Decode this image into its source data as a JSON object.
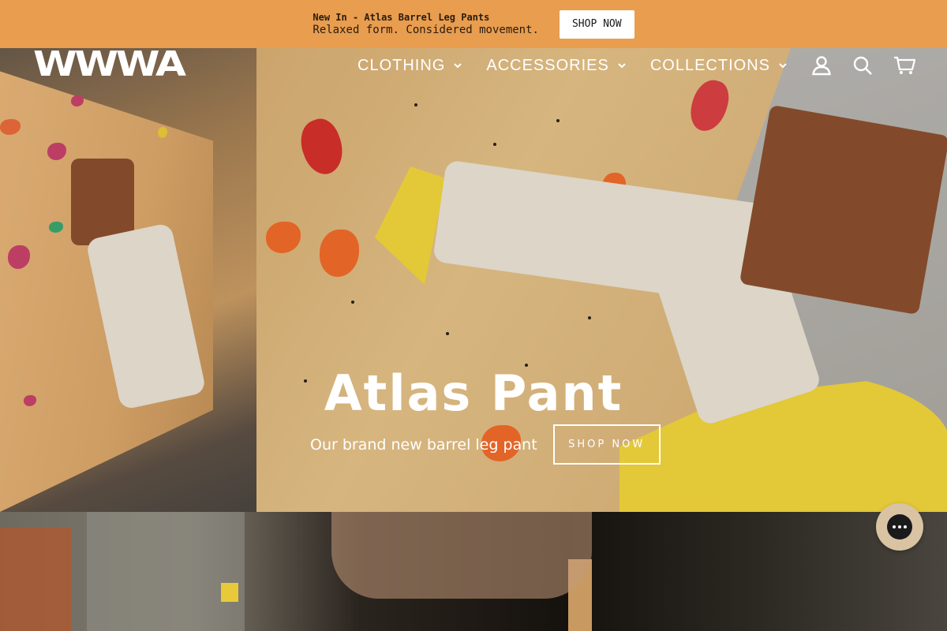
{
  "announcement": {
    "title": "New In - Atlas Barrel Leg Pants",
    "subtitle": "Relaxed form. Considered movement.",
    "button_label": "SHOP NOW"
  },
  "header": {
    "logo_text": "WWWA",
    "nav": [
      {
        "label": "CLOTHING",
        "icon": "chevron-down-icon"
      },
      {
        "label": "ACCESSORIES",
        "icon": "chevron-down-icon"
      },
      {
        "label": "COLLECTIONS",
        "icon": "chevron-down-icon"
      }
    ],
    "icons": [
      "account-icon",
      "search-icon",
      "cart-icon"
    ]
  },
  "hero": {
    "title": "Atlas Pant",
    "subtitle": "Our brand new barrel leg pant",
    "button_label": "SHOP NOW"
  },
  "chat": {
    "icon": "chat-icon"
  },
  "colors": {
    "announcement_bg": "#e89d4f",
    "chat_bg": "#d9c3a3"
  }
}
